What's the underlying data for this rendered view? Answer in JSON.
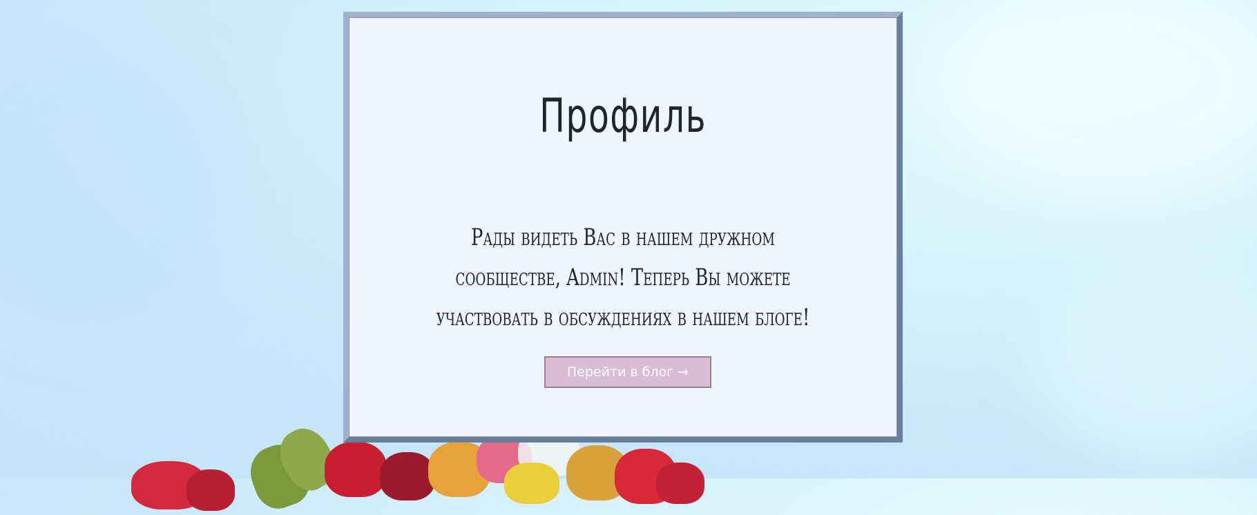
{
  "profile": {
    "title": "Профиль",
    "message": "Рады видеть Вас в нашем дружном сообществе, Admin! Теперь Вы можете участвовать в обсуждениях в нашем блоге!",
    "button_label": "Перейти в блог →"
  },
  "colors": {
    "page_background": "#c7e6f8",
    "card_background": "#eef5fe",
    "card_border": "#7a8daa",
    "button_background": "#d9bcd6",
    "button_border": "#9a7f9a",
    "text": "#1e2430"
  }
}
